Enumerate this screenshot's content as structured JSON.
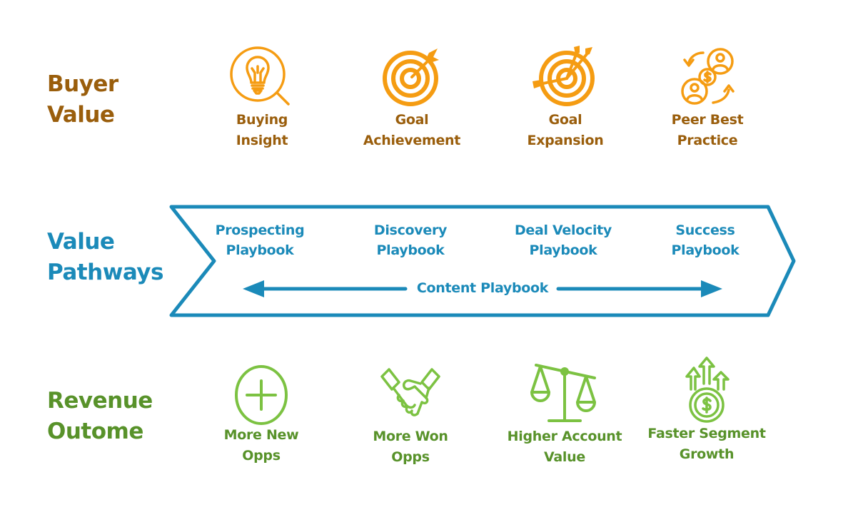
{
  "colors": {
    "buyer": "#9a5e0c",
    "buyer_icon": "#f59c12",
    "pathway": "#1b8ab9",
    "revenue": "#58922a",
    "revenue_icon": "#7cc242"
  },
  "rows": {
    "buyer_value": {
      "label": [
        "Buyer",
        "Value"
      ],
      "items": [
        {
          "icon": "lightbulb-magnifier-icon",
          "caption": [
            "Buying",
            "Insight"
          ]
        },
        {
          "icon": "target-arrow-icon",
          "caption": [
            "Goal",
            "Achievement"
          ]
        },
        {
          "icon": "target-multiple-arrows-icon",
          "caption": [
            "Goal",
            "Expansion"
          ]
        },
        {
          "icon": "peer-exchange-icon",
          "caption": [
            "Peer Best",
            "Practice"
          ]
        }
      ]
    },
    "value_pathways": {
      "label": [
        "Value",
        "Pathways"
      ],
      "playbooks": [
        [
          "Prospecting",
          "Playbook"
        ],
        [
          "Discovery",
          "Playbook"
        ],
        [
          "Deal Velocity",
          "Playbook"
        ],
        [
          "Success",
          "Playbook"
        ]
      ],
      "content_playbook": "Content Playbook"
    },
    "revenue_outcome": {
      "label": [
        "Revenue",
        "Outome"
      ],
      "items": [
        {
          "icon": "plus-circle-icon",
          "caption": [
            "More New",
            "Opps"
          ]
        },
        {
          "icon": "handshake-icon",
          "caption": [
            "More Won",
            "Opps"
          ]
        },
        {
          "icon": "balance-scale-icon",
          "caption": [
            "Higher Account",
            "Value"
          ]
        },
        {
          "icon": "dollar-growth-arrows-icon",
          "caption": [
            "Faster Segment",
            "Growth"
          ]
        }
      ]
    }
  }
}
